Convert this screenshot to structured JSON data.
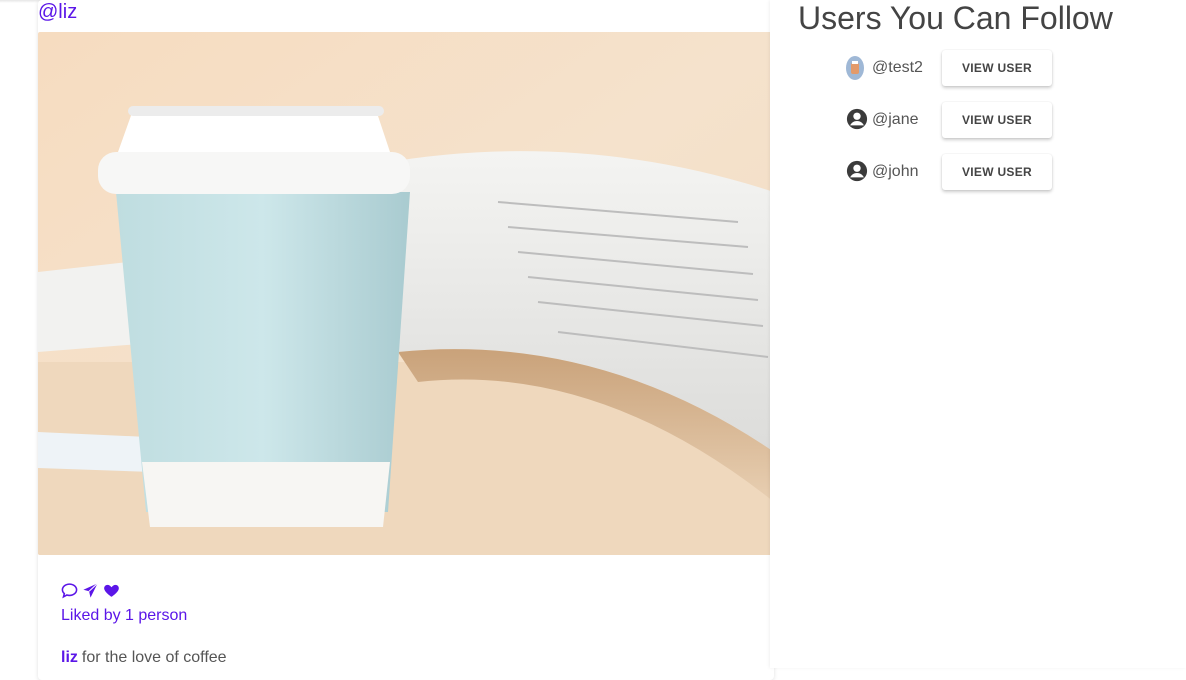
{
  "post": {
    "username": "@liz",
    "image_alt": "coffee-cup-and-open-magazine",
    "liked_by": "Liked by 1 person",
    "caption_user": "liz",
    "caption_text": "for the love of coffee",
    "icons": [
      "comment-icon",
      "send-icon",
      "heart-icon"
    ],
    "accent_color": "#5b16e8"
  },
  "suggestions": {
    "title": "Users You Can Follow",
    "users": [
      {
        "handle": "@test2",
        "button_label": "VIEW USER",
        "avatar": "photo-avatar"
      },
      {
        "handle": "@jane",
        "button_label": "VIEW USER",
        "avatar": "default-avatar-icon"
      },
      {
        "handle": "@john",
        "button_label": "VIEW USER",
        "avatar": "default-avatar-icon"
      }
    ]
  }
}
